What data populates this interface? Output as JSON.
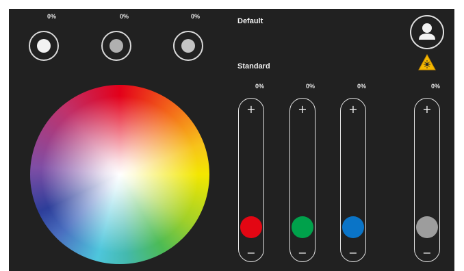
{
  "presets": [
    {
      "percent": "0%",
      "dot_color": "#f2f2f2"
    },
    {
      "percent": "0%",
      "dot_color": "#b0b0b0"
    },
    {
      "percent": "0%",
      "dot_color": "#c4c4c4"
    }
  ],
  "labels": {
    "default": "Default",
    "standard": "Standard"
  },
  "sliders": [
    {
      "percent": "0%",
      "plus": "+",
      "minus": "−",
      "knob_color": "#e30613",
      "level": 0
    },
    {
      "percent": "0%",
      "plus": "+",
      "minus": "−",
      "knob_color": "#00a14b",
      "level": 0
    },
    {
      "percent": "0%",
      "plus": "+",
      "minus": "−",
      "knob_color": "#0a74c7",
      "level": 0
    },
    {
      "percent": "0%",
      "plus": "+",
      "minus": "−",
      "knob_color": "#9d9d9d",
      "level": 0
    }
  ],
  "icons": {
    "avatar": "user-icon",
    "warning": "uv-warning-icon"
  },
  "colors": {
    "panel_bg": "#212121",
    "warning": "#f5b800"
  }
}
